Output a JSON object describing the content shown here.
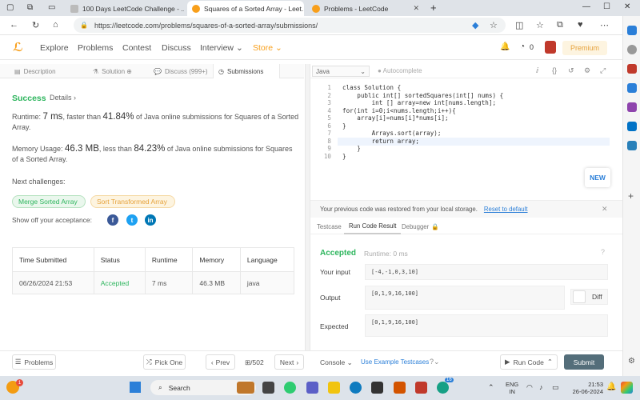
{
  "browser": {
    "tabs": [
      {
        "title": "100 Days LeetCode Challenge - ...",
        "active": false
      },
      {
        "title": "Squares of a Sorted Array - Leet...",
        "active": true
      },
      {
        "title": "Problems - LeetCode",
        "active": false
      }
    ],
    "url": "https://leetcode.com/problems/squares-of-a-sorted-array/submissions/"
  },
  "nav": {
    "links": [
      "Explore",
      "Problems",
      "Contest",
      "Discuss",
      "Interview",
      "Store"
    ],
    "notifications": "0",
    "premium_label": "Premium"
  },
  "left_tabs": [
    "Description",
    "Solution",
    "Discuss (999+)",
    "Submissions"
  ],
  "result": {
    "status": "Success",
    "details_label": "Details",
    "runtime_prefix": "Runtime: ",
    "runtime_value": "7 ms",
    "runtime_mid": ", faster than ",
    "runtime_pct": "41.84%",
    "runtime_suffix": " of Java online submissions for Squares of a Sorted Array.",
    "memory_prefix": "Memory Usage: ",
    "memory_value": "46.3 MB",
    "memory_mid": ", less than ",
    "memory_pct": "84.23%",
    "memory_suffix": " of Java online submissions for Squares of a Sorted Array.",
    "next_label": "Next challenges:",
    "challenges": [
      "Merge Sorted Array",
      "Sort Transformed Array"
    ],
    "share_label": "Show off your acceptance:"
  },
  "table": {
    "headers": [
      "Time Submitted",
      "Status",
      "Runtime",
      "Memory",
      "Language"
    ],
    "row": [
      "06/26/2024 21:53",
      "Accepted",
      "7 ms",
      "46.3 MB",
      "java"
    ]
  },
  "bottom": {
    "problems_label": "Problems",
    "pick_one_label": "Pick One",
    "prev_label": "Prev",
    "page_counter": "/502",
    "next_label": "Next",
    "console_label": "Console",
    "use_example_label": "Use Example Testcases",
    "run_code_label": "Run Code",
    "submit_label": "Submit"
  },
  "editor": {
    "language": "Java",
    "autocomplete": "Autocomplete",
    "lines": [
      "class Solution {",
      "    public int[] sortedSquares(int[] nums) {",
      "        int [] array=new int[nums.length];",
      "for(int i=0;i<nums.length;i++){",
      "    array[i]=nums[i]*nums[i];",
      "}",
      "        Arrays.sort(array);",
      "        return array;",
      "    }",
      "}"
    ],
    "new_badge": "NEW",
    "restored_msg": "Your previous code was restored from your local storage.",
    "reset_label": "Reset to default"
  },
  "run_result": {
    "tabs": [
      "Testcase",
      "Run Code Result",
      "Debugger"
    ],
    "status": "Accepted",
    "runtime": "Runtime: 0 ms",
    "input_label": "Your input",
    "input_value": "[-4,-1,0,3,10]",
    "output_label": "Output",
    "output_value": "[0,1,9,16,100]",
    "expected_label": "Expected",
    "expected_value": "[0,1,9,16,100]",
    "diff_label": "Diff"
  },
  "taskbar": {
    "search_placeholder": "Search",
    "lang_line1": "ENG",
    "lang_line2": "IN",
    "time": "21:53",
    "date": "26-06-2024",
    "badge_count": "16"
  },
  "colors": {
    "success": "#2db55d",
    "link": "#2b7fd8",
    "premium": "#e6a23c"
  }
}
